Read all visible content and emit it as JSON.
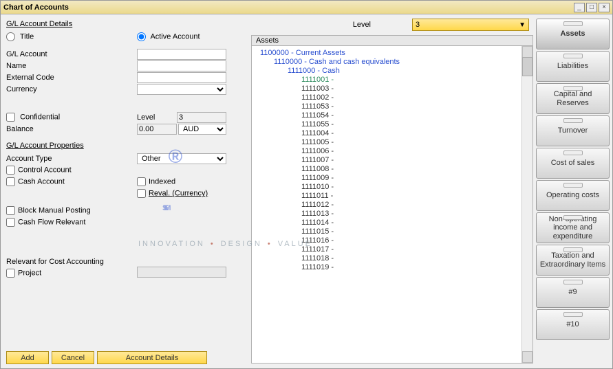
{
  "window": {
    "title": "Chart of Accounts"
  },
  "titlebar_icons": {
    "min": "_",
    "max": "□",
    "close": "×"
  },
  "level_row": {
    "label": "Level",
    "value": "3"
  },
  "section_details": "G/L Account Details",
  "radio_title": "Title",
  "radio_active": "Active Account",
  "radio_selected": "active",
  "fields": {
    "gl_account": "G/L Account",
    "name": "Name",
    "external_code": "External Code",
    "currency": "Currency"
  },
  "confidential": {
    "label": "Confidential",
    "checked": false
  },
  "level_field": {
    "label": "Level",
    "value": "3"
  },
  "balance": {
    "label": "Balance",
    "value": "0.00",
    "currency": "AUD"
  },
  "section_props": "G/L Account Properties",
  "account_type": {
    "label": "Account Type",
    "value": "Other"
  },
  "control_account": {
    "label": "Control Account",
    "checked": false
  },
  "cash_account": {
    "label": "Cash Account",
    "checked": false
  },
  "indexed": {
    "label": "Indexed",
    "checked": false
  },
  "reval": {
    "label": "Reval. (Currency)",
    "checked": false
  },
  "block_manual": {
    "label": "Block Manual Posting",
    "checked": false
  },
  "cash_flow": {
    "label": "Cash Flow Relevant",
    "checked": false
  },
  "relevant_section": "Relevant for Cost Accounting",
  "project": {
    "label": "Project",
    "checked": false
  },
  "buttons": {
    "add": "Add",
    "cancel": "Cancel",
    "details": "Account Details"
  },
  "tree": {
    "header": "Assets",
    "root": {
      "code": "1100000",
      "name": "Current Assets"
    },
    "lvl2": {
      "code": "1110000",
      "name": "Cash and cash equivalents"
    },
    "lvl3": {
      "code": "1111000",
      "name": "Cash"
    },
    "selected": "1111001",
    "leaves": [
      "1111001",
      "1111003",
      "1111002",
      "1111053",
      "1111054",
      "1111055",
      "1111004",
      "1111005",
      "1111006",
      "1111007",
      "1111008",
      "1111009",
      "1111010",
      "1111011",
      "1111012",
      "1111013",
      "1111014",
      "1111015",
      "1111016",
      "1111017",
      "1111018",
      "1111019"
    ]
  },
  "drawers": [
    "Assets",
    "Liabilities",
    "Capital and Reserves",
    "Turnover",
    "Cost of sales",
    "Operating costs",
    "Non-operating income and expenditure",
    "Taxation and Extraordinary Items",
    "#9",
    "#10"
  ],
  "drawer_active_index": 0,
  "watermark": {
    "main": "STEM",
    "reg": "®",
    "sub_a": "INNOVATION",
    "sub_b": "DESIGN",
    "sub_c": "VALUE"
  }
}
